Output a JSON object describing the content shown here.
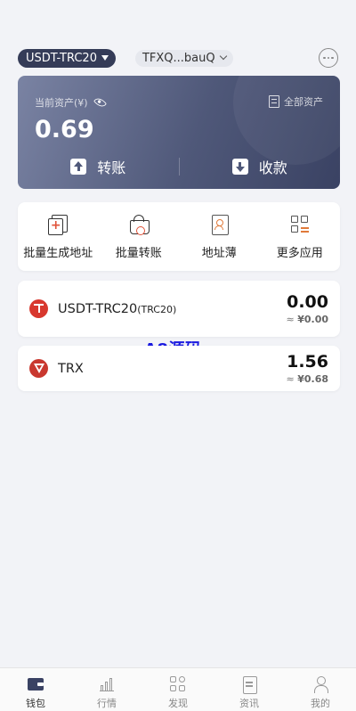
{
  "header": {
    "token_selector": "USDT-TRC20",
    "address_selector": "TFXQ...bauQ",
    "message_icon": "chat-bubble-icon"
  },
  "asset_card": {
    "label": "当前资产(¥)",
    "all_assets_label": "全部资产",
    "balance": "0.69",
    "transfer_label": "转账",
    "receive_label": "收款"
  },
  "apps": [
    {
      "label": "批量生成地址",
      "icon": "copy-plus-icon"
    },
    {
      "label": "批量转账",
      "icon": "basket-icon"
    },
    {
      "label": "地址薄",
      "icon": "contact-book-icon"
    },
    {
      "label": "更多应用",
      "icon": "grid-icon"
    }
  ],
  "tokens": [
    {
      "name": "USDT-TRC20",
      "sub": "(TRC20)",
      "amount": "0.00",
      "fiat_prefix": "≈",
      "fiat": "¥0.00"
    },
    {
      "name": "TRX",
      "sub": "",
      "amount": "1.56",
      "fiat_prefix": "≈",
      "fiat": "¥0.68"
    }
  ],
  "watermark": "A8源码",
  "nav": [
    {
      "label": "钱包",
      "active": true
    },
    {
      "label": "行情",
      "active": false
    },
    {
      "label": "发现",
      "active": false
    },
    {
      "label": "资讯",
      "active": false
    },
    {
      "label": "我的",
      "active": false
    }
  ],
  "colors": {
    "card_dark": "#3a4263",
    "card_light": "#7a83a3",
    "accent_orange": "#e07a3a",
    "trx_red": "#c9382f",
    "watermark_blue": "#1a1ae0"
  }
}
